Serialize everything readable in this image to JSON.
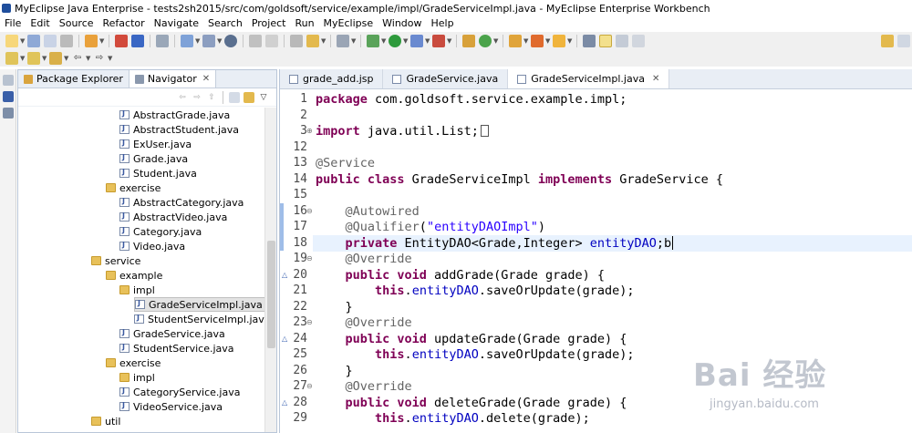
{
  "window": {
    "title": "MyEclipse Java Enterprise - tests2sh2015/src/com/goldsoft/service/example/impl/GradeServiceImpl.java - MyEclipse Enterprise Workbench"
  },
  "menubar": [
    "File",
    "Edit",
    "Source",
    "Refactor",
    "Navigate",
    "Search",
    "Project",
    "Run",
    "MyEclipse",
    "Window",
    "Help"
  ],
  "navigator": {
    "tabs": [
      {
        "label": "Package Explorer",
        "active": false
      },
      {
        "label": "Navigator",
        "active": true,
        "close": "✕"
      }
    ],
    "tree": [
      {
        "label": "AbstractGrade.java",
        "kind": "java",
        "indent": 2
      },
      {
        "label": "AbstractStudent.java",
        "kind": "java",
        "indent": 2
      },
      {
        "label": "ExUser.java",
        "kind": "java",
        "indent": 2
      },
      {
        "label": "Grade.java",
        "kind": "java",
        "indent": 2
      },
      {
        "label": "Student.java",
        "kind": "java",
        "indent": 2
      },
      {
        "label": "exercise",
        "kind": "folder",
        "indent": 1
      },
      {
        "label": "AbstractCategory.java",
        "kind": "java",
        "indent": 2
      },
      {
        "label": "AbstractVideo.java",
        "kind": "java",
        "indent": 2
      },
      {
        "label": "Category.java",
        "kind": "java",
        "indent": 2
      },
      {
        "label": "Video.java",
        "kind": "java",
        "indent": 2
      },
      {
        "label": "service",
        "kind": "folder",
        "indent": 0
      },
      {
        "label": "example",
        "kind": "folder",
        "indent": 1
      },
      {
        "label": "impl",
        "kind": "folder",
        "indent": 2
      },
      {
        "label": "GradeServiceImpl.java",
        "kind": "java",
        "indent": 3,
        "selected": true
      },
      {
        "label": "StudentServiceImpl.java",
        "kind": "java",
        "indent": 3
      },
      {
        "label": "GradeService.java",
        "kind": "java",
        "indent": 2
      },
      {
        "label": "StudentService.java",
        "kind": "java",
        "indent": 2
      },
      {
        "label": "exercise",
        "kind": "folder",
        "indent": 1
      },
      {
        "label": "impl",
        "kind": "folder",
        "indent": 2
      },
      {
        "label": "CategoryService.java",
        "kind": "java",
        "indent": 2
      },
      {
        "label": "VideoService.java",
        "kind": "java",
        "indent": 2
      },
      {
        "label": "util",
        "kind": "folder",
        "indent": 0
      }
    ]
  },
  "editor": {
    "tabs": [
      {
        "label": "grade_add.jsp",
        "active": false
      },
      {
        "label": "GradeService.java",
        "active": false
      },
      {
        "label": "GradeServiceImpl.java",
        "active": true,
        "close": "✕"
      }
    ],
    "lines": [
      {
        "num": "1",
        "html": "<span class=\"kw\">package</span> com.goldsoft.service.example.impl;"
      },
      {
        "num": "2",
        "html": ""
      },
      {
        "num": "3",
        "fold": "⊕",
        "html": "<span class=\"kw\">import</span> java.util.List;<span class=\"box\"></span>"
      },
      {
        "num": "12",
        "html": ""
      },
      {
        "num": "13",
        "html": "<span class=\"ann\">@Service</span>"
      },
      {
        "num": "14",
        "html": "<span class=\"kw\">public class</span> GradeServiceImpl <span class=\"kw\">implements</span> GradeService {"
      },
      {
        "num": "15",
        "html": ""
      },
      {
        "num": "16",
        "fold": "⊖",
        "html": "    <span class=\"ann\">@Autowired</span>"
      },
      {
        "num": "17",
        "html": "    <span class=\"ann\">@Qualifier</span>(<span class=\"str\">\"entityDAOImpl\"</span>)"
      },
      {
        "num": "18",
        "current": true,
        "html": "    <span class=\"kw\">private</span> EntityDAO&lt;Grade,Integer&gt; <span class=\"fld\">entityDAO</span>;b<span class=\"cursor\"></span>"
      },
      {
        "num": "19",
        "fold": "⊖",
        "html": "    <span class=\"ann\">@Override</span>"
      },
      {
        "num": "20",
        "override": "△",
        "html": "    <span class=\"kw\">public void</span> addGrade(Grade grade) {"
      },
      {
        "num": "21",
        "html": "        <span class=\"kw\">this</span>.<span class=\"fld\">entityDAO</span>.saveOrUpdate(grade);"
      },
      {
        "num": "22",
        "html": "    }"
      },
      {
        "num": "23",
        "fold": "⊖",
        "html": "    <span class=\"ann\">@Override</span>"
      },
      {
        "num": "24",
        "override": "△",
        "html": "    <span class=\"kw\">public void</span> updateGrade(Grade grade) {"
      },
      {
        "num": "25",
        "html": "        <span class=\"kw\">this</span>.<span class=\"fld\">entityDAO</span>.saveOrUpdate(grade);"
      },
      {
        "num": "26",
        "html": "    }"
      },
      {
        "num": "27",
        "fold": "⊖",
        "html": "    <span class=\"ann\">@Override</span>"
      },
      {
        "num": "28",
        "override": "△",
        "html": "    <span class=\"kw\">public void</span> deleteGrade(Grade grade) {"
      },
      {
        "num": "29",
        "html": "        <span class=\"kw\">this</span>.<span class=\"fld\">entityDAO</span>.delete(grade);"
      }
    ]
  },
  "watermark": {
    "logo": "Bai 经验",
    "url": "jingyan.baidu.com"
  },
  "colors": {
    "keyword": "#7f0055",
    "annotation": "#646464",
    "string": "#2a00ff",
    "field": "#0000c0",
    "current_line": "#e8f2fe"
  }
}
